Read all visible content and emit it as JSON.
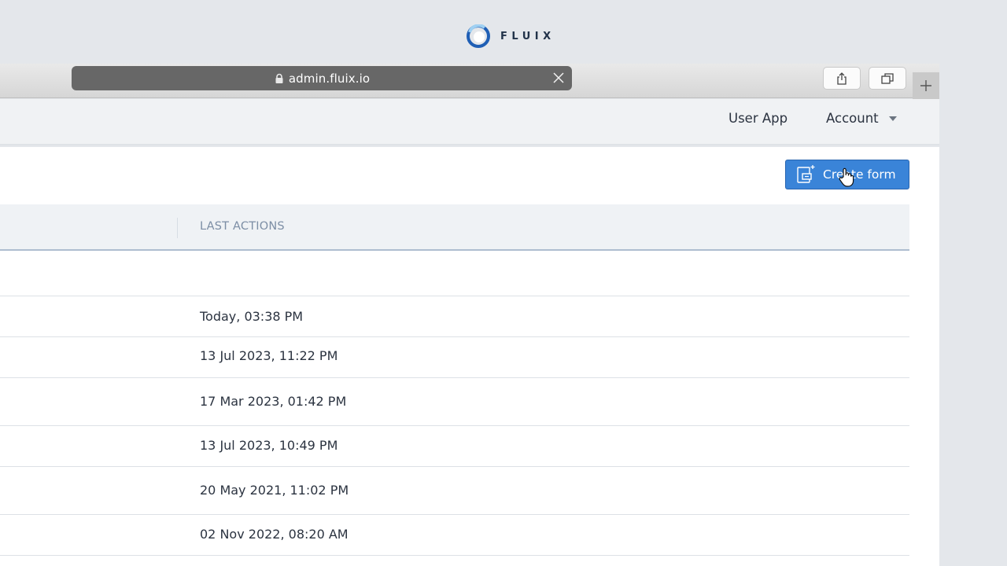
{
  "brand": {
    "name": "FLUIX"
  },
  "browser": {
    "url": "admin.fluix.io"
  },
  "header": {
    "nav": [
      {
        "label": "User App"
      },
      {
        "label": "Account"
      }
    ]
  },
  "toolbar": {
    "create_label": "Create form"
  },
  "table": {
    "columns": [
      "LAST ACTIONS"
    ],
    "rows": [
      {
        "last_action": ""
      },
      {
        "last_action": "Today, 03:38 PM"
      },
      {
        "last_action": "13 Jul 2023, 11:22 PM"
      },
      {
        "last_action": "17 Mar 2023, 01:42 PM"
      },
      {
        "last_action": "13 Jul 2023, 10:49 PM"
      },
      {
        "last_action": "20 May 2021, 11:02 PM"
      },
      {
        "last_action": "02 Nov 2022, 08:20 AM"
      }
    ]
  },
  "colors": {
    "accent": "#3a84d8",
    "brand_blue": "#1f5fb5",
    "header_bg": "#f0f2f4",
    "muted_text": "#7c8ea5"
  }
}
